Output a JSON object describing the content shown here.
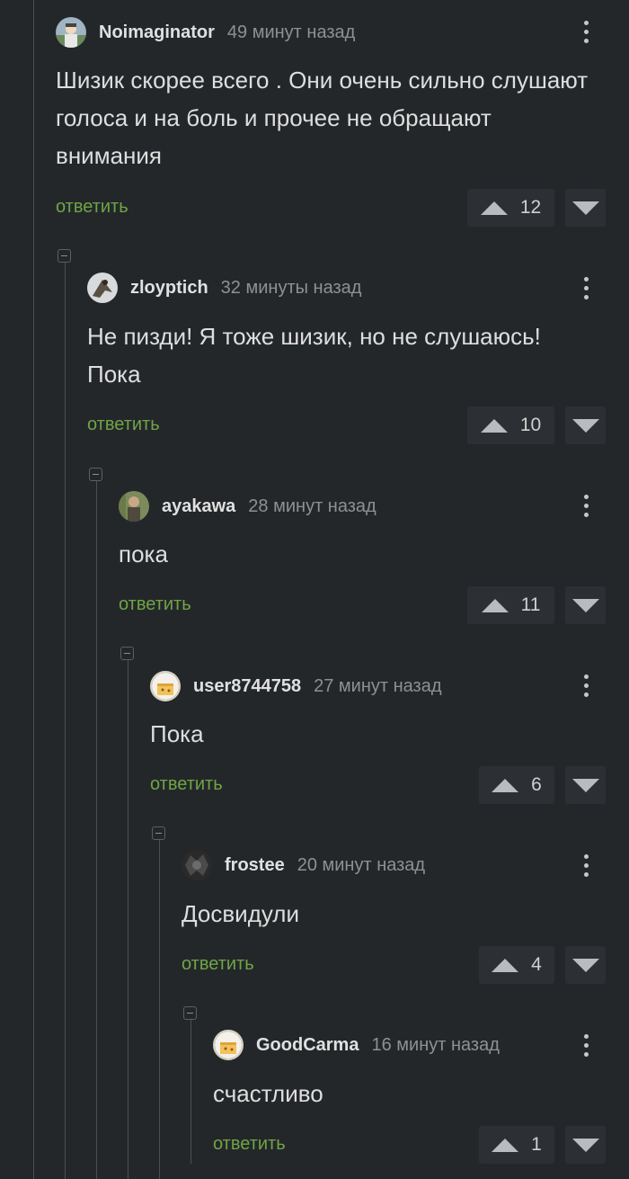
{
  "comments": [
    {
      "username": "Noimaginator",
      "time": "49 минут назад",
      "text": "Шизик скорее всего . Они очень сильно слушают голоса и на боль и прочее не обращают внимания",
      "reply": "ответить",
      "score": "12"
    },
    {
      "username": "zloyptich",
      "time": "32 минуты назад",
      "text": "Не пизди! Я тоже шизик, но не слушаюсь! Пока",
      "reply": "ответить",
      "score": "10"
    },
    {
      "username": "ayakawa",
      "time": "28 минут назад",
      "text": "пока",
      "reply": "ответить",
      "score": "11"
    },
    {
      "username": "user8744758",
      "time": "27 минут назад",
      "text": "Пока",
      "reply": "ответить",
      "score": "6"
    },
    {
      "username": "frostee",
      "time": "20 минут назад",
      "text": "Досвидули",
      "reply": "ответить",
      "score": "4"
    },
    {
      "username": "GoodCarma",
      "time": "16 минут назад",
      "text": "счастливо",
      "reply": "ответить",
      "score": "1"
    }
  ],
  "icons": {
    "collapse": "minus-square-icon",
    "more": "more-vertical-icon",
    "upvote": "triangle-up-icon",
    "downvote": "triangle-down-icon"
  },
  "colors": {
    "background": "#24272a",
    "reply_link": "#6fa545",
    "thread_line": "#4b4e52"
  }
}
